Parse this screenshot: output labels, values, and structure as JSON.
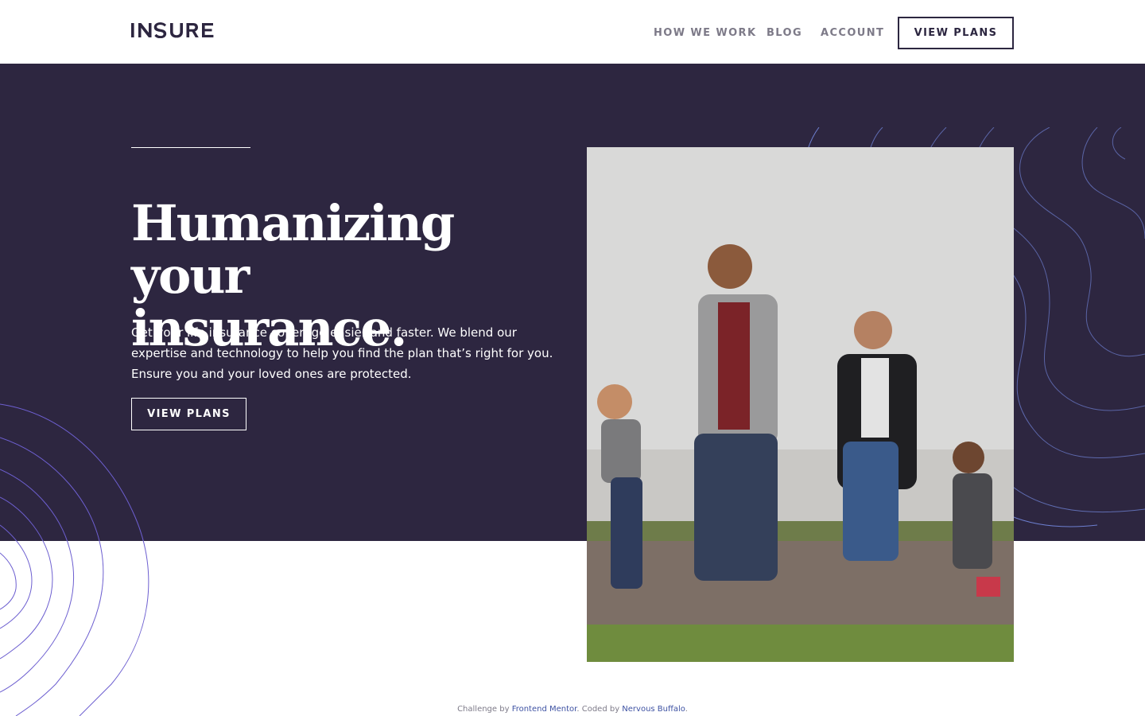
{
  "brand": {
    "logo_text": "INSURE",
    "dark_color": "#2d2640",
    "accent_line": "#6d5fd0"
  },
  "nav": {
    "items": [
      {
        "label": "HOW WE WORK"
      },
      {
        "label": "BLOG"
      },
      {
        "label": "ACCOUNT"
      }
    ],
    "cta_label": "VIEW PLANS"
  },
  "hero": {
    "title_line1": "Humanizing your",
    "title_line2": "insurance.",
    "body": "Get your life insurance coverage easier and faster. We blend our expertise and technology to help you find the plan that’s right for you. Ensure you and your loved ones are protected.",
    "cta_label": "VIEW PLANS",
    "image_alt": "Family of four walking hand in hand"
  },
  "attribution": {
    "prefix": "Challenge by ",
    "challenge_link": "Frontend Mentor",
    "middle": ". Coded by ",
    "author_link": "Nervous Buffalo",
    "suffix": "."
  }
}
